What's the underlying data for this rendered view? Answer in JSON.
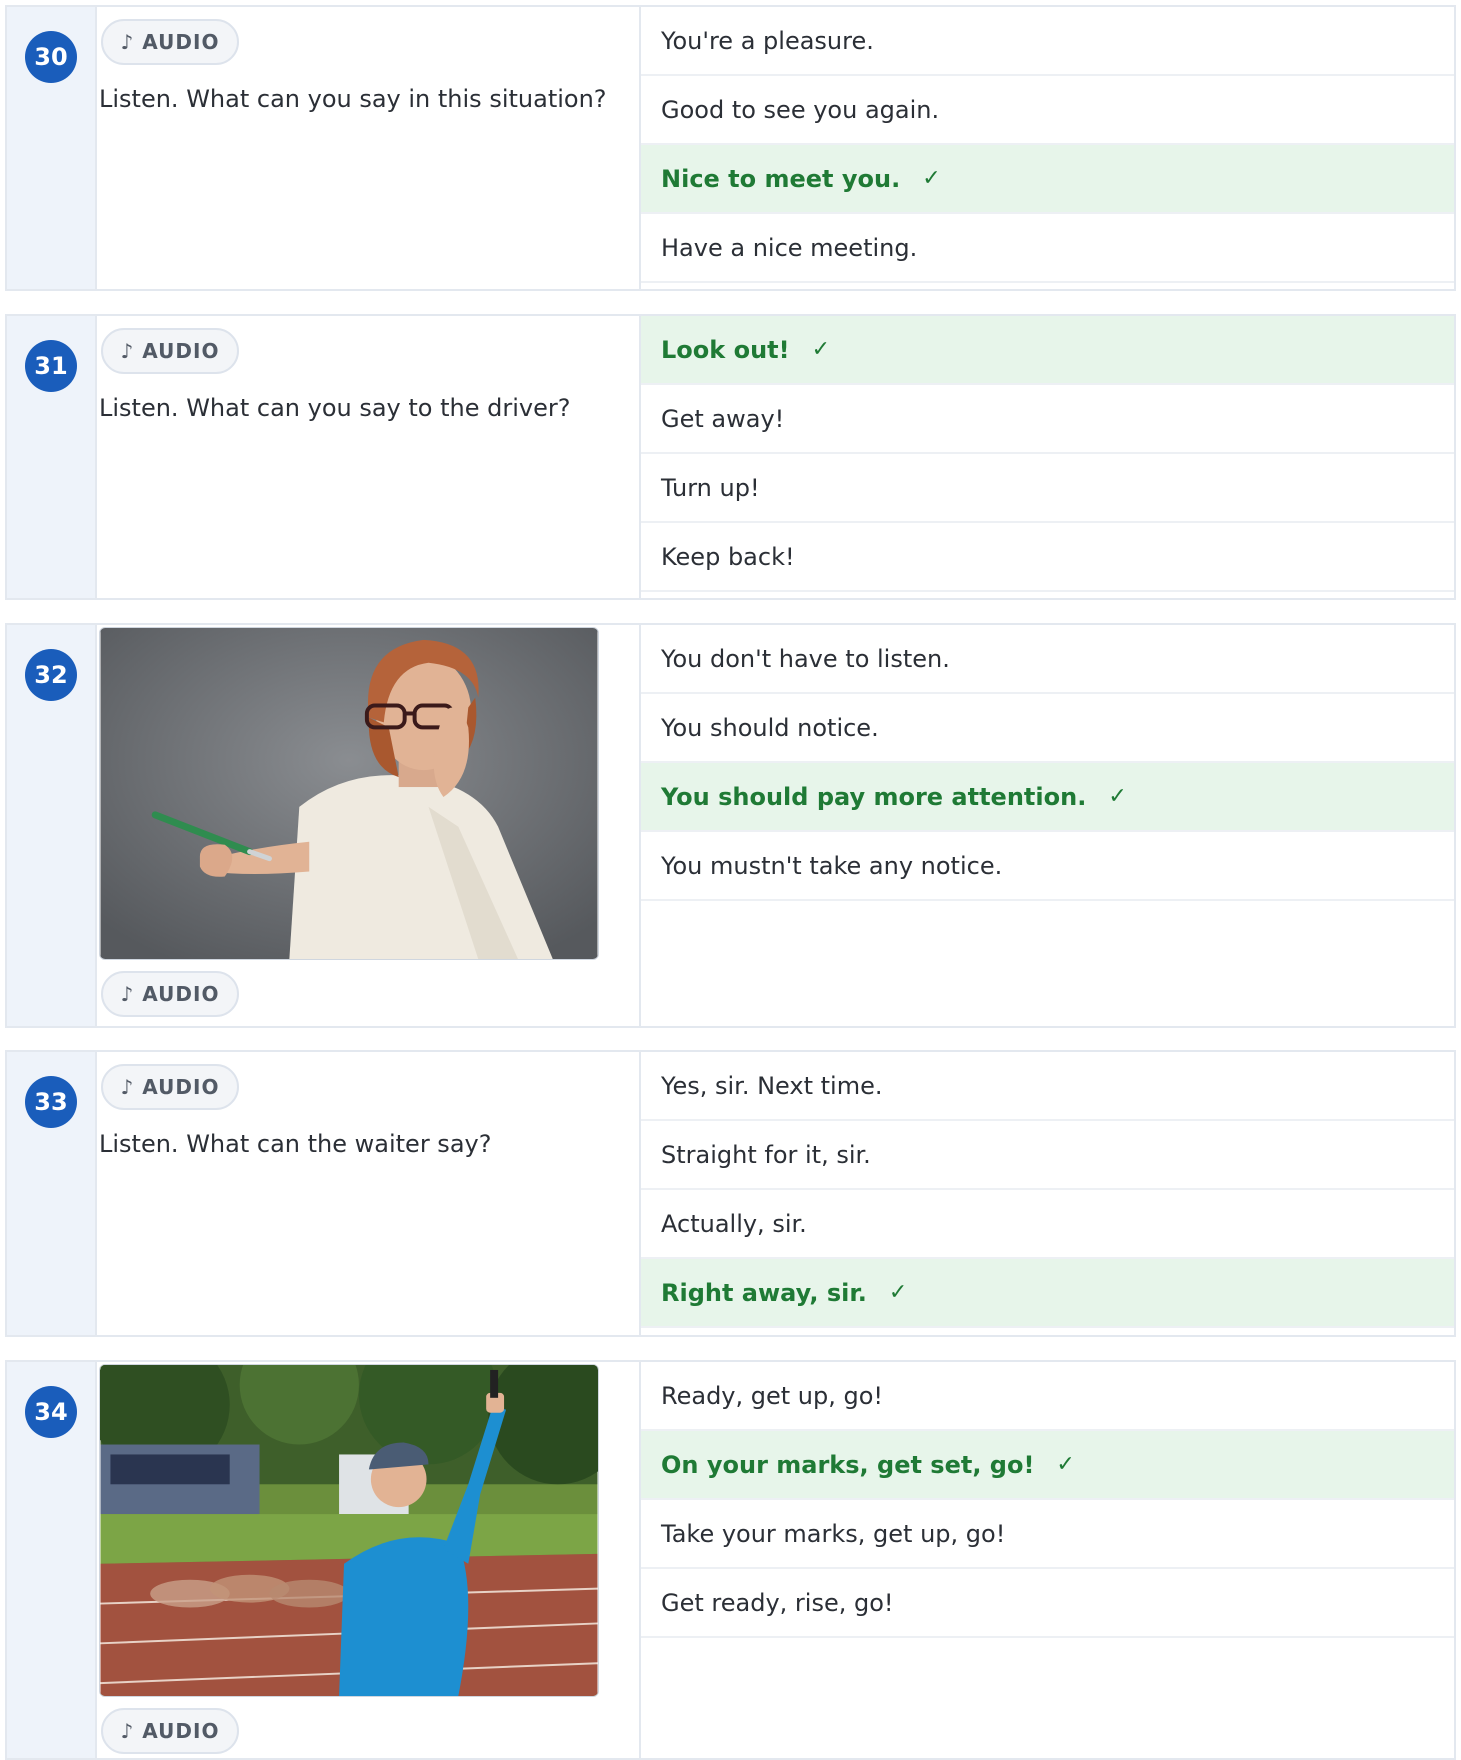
{
  "audio_label": "AUDIO",
  "audio_icon": "music-note-icon",
  "check_mark": "✓",
  "colors": {
    "badge": "#1a5dbb",
    "correct_bg": "#e7f5ea",
    "correct_text": "#1f7a35"
  },
  "questions": [
    {
      "number": "30",
      "prompt": "Listen. What can you say in this situation?",
      "options": [
        {
          "text": "You're a pleasure.",
          "correct": false
        },
        {
          "text": "Good to see you again.",
          "correct": false
        },
        {
          "text": "Nice to meet you.",
          "correct": true
        },
        {
          "text": "Have a nice meeting.",
          "correct": false
        }
      ]
    },
    {
      "number": "31",
      "prompt": "Listen. What can you say to the driver?",
      "options": [
        {
          "text": "Look out!",
          "correct": true
        },
        {
          "text": "Get away!",
          "correct": false
        },
        {
          "text": "Turn up!",
          "correct": false
        },
        {
          "text": "Keep back!",
          "correct": false
        }
      ]
    },
    {
      "number": "32",
      "image": "photo of a woman in glasses holding a pen",
      "options": [
        {
          "text": "You don't have to listen.",
          "correct": false
        },
        {
          "text": "You should notice.",
          "correct": false
        },
        {
          "text": "You should pay more attention.",
          "correct": true
        },
        {
          "text": "You mustn't take any notice.",
          "correct": false
        }
      ]
    },
    {
      "number": "33",
      "prompt": "Listen. What can the waiter say?",
      "options": [
        {
          "text": "Yes, sir. Next time.",
          "correct": false
        },
        {
          "text": "Straight for it, sir.",
          "correct": false
        },
        {
          "text": "Actually, sir.",
          "correct": false
        },
        {
          "text": "Right away, sir.",
          "correct": true
        }
      ]
    },
    {
      "number": "34",
      "image": "photo of a race starter holding a starting pistol at a running track",
      "options": [
        {
          "text": "Ready, get up, go!",
          "correct": false
        },
        {
          "text": "On your marks, get set, go!",
          "correct": true
        },
        {
          "text": "Take your marks, get up, go!",
          "correct": false
        },
        {
          "text": "Get ready, rise, go!",
          "correct": false
        }
      ]
    }
  ]
}
